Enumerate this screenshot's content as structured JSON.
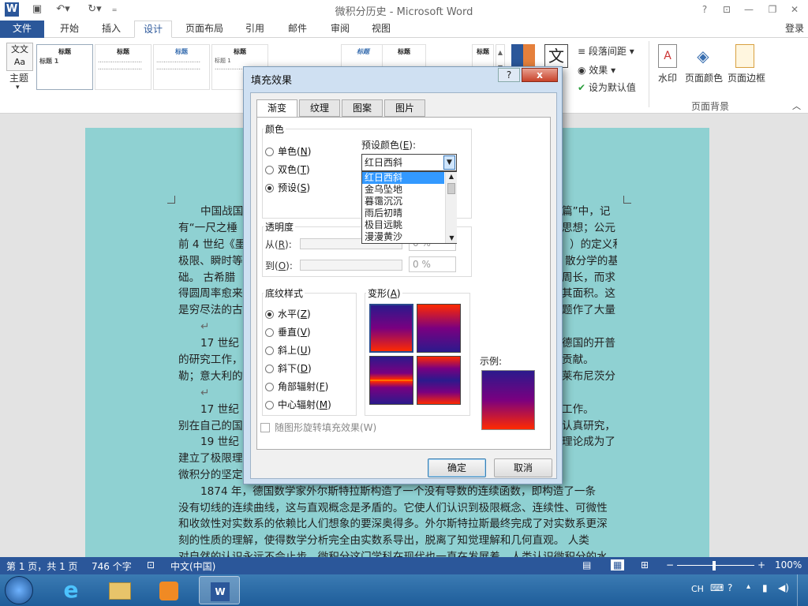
{
  "window": {
    "title": "微积分历史 - Microsoft Word",
    "help": "?",
    "login": "登录"
  },
  "quick_access": {
    "app_icon": "W",
    "save_icon": "save-icon",
    "undo_icon": "undo-icon",
    "redo_icon": "redo-icon"
  },
  "ribbon_tabs": [
    "文件",
    "开始",
    "插入",
    "设计",
    "页面布局",
    "引用",
    "邮件",
    "审阅",
    "视图"
  ],
  "ribbon": {
    "theme_label": "主题",
    "gallery": [
      {
        "title": "标题",
        "sub": "标题 1"
      },
      {
        "title": "标题",
        "sub": ""
      },
      {
        "title": "标题",
        "sub": ""
      },
      {
        "title": "标题",
        "sub": "标题 1"
      },
      {
        "title": "标题",
        "sub": "标题 1"
      },
      {
        "title": "标题",
        "sub": ""
      }
    ],
    "gallery_tail": [
      "标题",
      "标题",
      "标题"
    ],
    "para_spacing": "段落间距",
    "effects": "效果",
    "set_default": "设为默认值",
    "watermark": "水印",
    "page_color": "页面颜色",
    "page_border": "页面边框",
    "group_label": "页面背景",
    "text_icon": "文"
  },
  "document": {
    "paragraphs": [
      "中国战国",
      "有“一尺之棰",
      "前 4 世纪《墨",
      "极限、瞬时等",
      "础。    古希腊",
      "得圆周率愈来",
      "是穷尽法的古",
      "17 世纪",
      "的研究工作，",
      "勒；意大利的",
      "17 世纪",
      "别在自己的国",
      "19 世纪",
      "建立了极限理",
      "微积分的坚定",
      "1874 年，德国数学家外尔斯特拉斯构造了一个没有导数的连续函数，即构造了一条",
      "没有切线的连续曲线，这与直观概念是矛盾的。它使人们认识到极限概念、连续性、可微性",
      "和收敛性对实数系的依赖比人们想象的要深奥得多。外尔斯特拉斯最终完成了对实数系更深",
      "刻的性质的理解，使得数学分析完全由实数系导出，脱离了知觉理解和几何直观。    人类",
      "对自然的认识永远不会止步，微积分这门学科在现代也一直在发展着，人类认识微积分的水"
    ],
    "right_fragments": [
      "篇”中，记",
      "思想；公元",
      "）的定义和",
      "散分学的基",
      "周长，而求",
      "其面积。这",
      "题作了大量",
      "德国的开普",
      "贡献。",
      "莱布尼茨分",
      "工作。",
      "认真研究，",
      "理论成为了"
    ]
  },
  "dialog": {
    "title": "填充效果",
    "help": "?",
    "close": "x",
    "tabs": [
      "渐变",
      "纹理",
      "图案",
      "图片"
    ],
    "color_group": "颜色",
    "color_options": [
      {
        "label": "单色",
        "key": "N",
        "selected": false
      },
      {
        "label": "双色",
        "key": "T",
        "selected": false
      },
      {
        "label": "预设",
        "key": "S",
        "selected": true
      }
    ],
    "preset_label": "预设颜色",
    "preset_key": "E",
    "preset_value": "红日西斜",
    "preset_options": [
      "红日西斜",
      "金乌坠地",
      "暮霭沉沉",
      "雨后初晴",
      "极目远眺",
      "漫漫黄沙"
    ],
    "transparency_group": "透明度",
    "from_label": "从",
    "from_key": "R",
    "to_label": "到",
    "to_key": "O",
    "from_value": "0 %",
    "to_value": "0 %",
    "shading_group": "底纹样式",
    "shading_options": [
      {
        "label": "水平",
        "key": "Z",
        "selected": true
      },
      {
        "label": "垂直",
        "key": "V",
        "selected": false
      },
      {
        "label": "斜上",
        "key": "U",
        "selected": false
      },
      {
        "label": "斜下",
        "key": "D",
        "selected": false
      },
      {
        "label": "角部辐射",
        "key": "F",
        "selected": false
      },
      {
        "label": "中心辐射",
        "key": "M",
        "selected": false
      }
    ],
    "variants_label": "变形",
    "variants_key": "A",
    "sample_label": "示例:",
    "rotate_checkbox": "随图形旋转填充效果(W)",
    "ok": "确定",
    "cancel": "取消",
    "gradient_colors": {
      "top": "#2b1a8c",
      "mid": "#7a0080",
      "bottom": "#ff2a00",
      "glow": "#ffa000"
    }
  },
  "status_bar": {
    "page": "第 1 页，共 1 页",
    "words": "746 个字",
    "lang": "中文(中国)",
    "zoom": "100%"
  },
  "taskbar": {
    "ime": "CH",
    "zoom_minus": "−",
    "zoom_plus": "+"
  }
}
